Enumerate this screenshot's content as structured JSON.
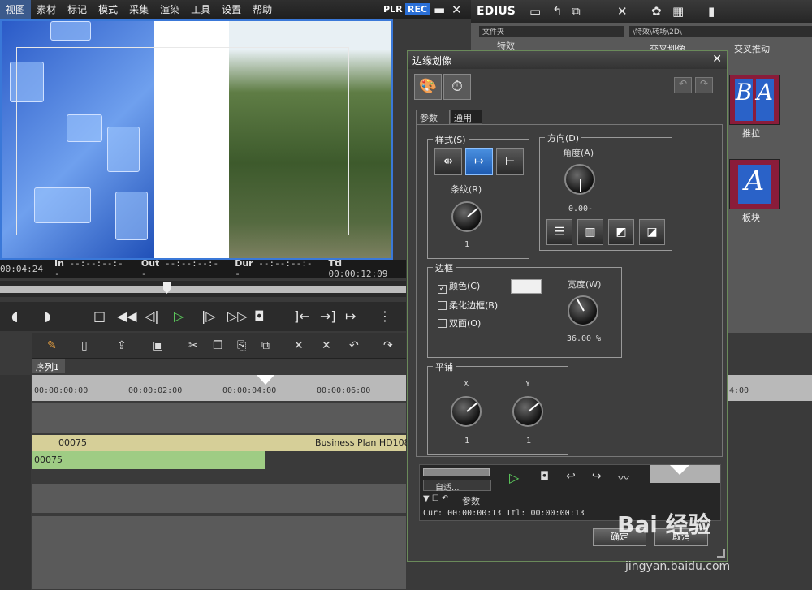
{
  "menu": [
    "视图",
    "素材",
    "标记",
    "模式",
    "采集",
    "渲染",
    "工具",
    "设置",
    "帮助"
  ],
  "player": {
    "plr": "PLR",
    "rec": "REC",
    "minimize": "▬",
    "close": "✕"
  },
  "timecode": {
    "cur": "00:04:24",
    "in_label": "In",
    "in_val": "--:--:--:--",
    "out_label": "Out",
    "out_val": "--:--:--:--",
    "dur_label": "Dur",
    "dur_val": "--:--:--:--",
    "ttl_label": "Ttl",
    "ttl_val": "00:00:12:09"
  },
  "sequence": {
    "tab": "序列1",
    "ruler": [
      "00:00:00:00",
      "00:00:02:00",
      "00:00:04:00",
      "00:00:06:00"
    ],
    "clip1": "00075",
    "clip1_b": "Business Plan HD1080",
    "clip2": "00075"
  },
  "rightpanel": {
    "app": "EDIUS",
    "folder_header": "文件夹",
    "path": "\\特效\\转场\\2D\\",
    "tree_item": "特效",
    "effects": [
      {
        "name": "交叉划像"
      },
      {
        "name": "交叉推动"
      },
      {
        "name": "推拉"
      },
      {
        "name": "板块"
      }
    ],
    "right_ruler": "4:00"
  },
  "dialog": {
    "title": "边缘划像",
    "close": "✕",
    "tabs": [
      "参数",
      "通用"
    ],
    "style_group": "样式(S)",
    "stripe_label": "条纹(R)",
    "stripe_value": "1",
    "direction_group": "方向(D)",
    "angle_label": "角度(A)",
    "angle_value": "0.00-",
    "border_group": "边框",
    "color_check": "颜色(C)",
    "soft_check": "柔化边框(B)",
    "double_check": "双面(O)",
    "width_label": "宽度(W)",
    "width_value": "36.00 %",
    "tile_group": "平铺",
    "tile_x_label": "X",
    "tile_y_label": "Y",
    "tile_x_value": "1",
    "tile_y_value": "1",
    "mini_dropdown": "自适...",
    "mini_param": "参数",
    "mini_status": "Cur: 00:00:00:13  Ttl: 00:00:00:13",
    "ok": "确定",
    "cancel": "取消"
  },
  "watermark": {
    "logo": "Bai 经验",
    "url": "jingyan.baidu.com"
  }
}
